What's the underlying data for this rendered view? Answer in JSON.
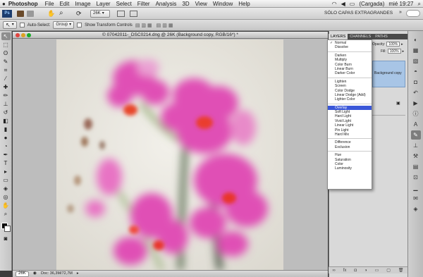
{
  "menubar": {
    "app_name": "Photoshop",
    "menus": [
      "File",
      "Edit",
      "Image",
      "Layer",
      "Select",
      "Filter",
      "Analysis",
      "3D",
      "View",
      "Window",
      "Help"
    ],
    "status": {
      "battery": "(Cargada)",
      "clock": "mié 19:27"
    }
  },
  "appbar": {
    "zoom": "26K",
    "workspace": "SÓLO CAPAS EXTRAGRANDES"
  },
  "options": {
    "auto_select_label": "Auto-Select:",
    "auto_select_value": "Group",
    "transform_label": "Show Transform Controls"
  },
  "document": {
    "title": "© 07042011-_DSC0214.dng @ 26K (Background copy, RGB/16*) *"
  },
  "status": {
    "zoom": "26K",
    "doc_size": "Doc: 36,3M/72,7M"
  },
  "panel": {
    "tabs": [
      "LAYERS",
      "CHANNELS",
      "PATHS"
    ],
    "opacity_label": "Opacity:",
    "opacity_value": "100%",
    "fill_label": "Fill:",
    "fill_value": "100%",
    "layer_name": "Background copy"
  },
  "blend_modes": {
    "groups": [
      [
        "Normal",
        "Dissolve"
      ],
      [
        "Darken",
        "Multiply",
        "Color Burn",
        "Linear Burn",
        "Darker Color"
      ],
      [
        "Lighten",
        "Screen",
        "Color Dodge",
        "Linear Dodge (Add)",
        "Lighter Color"
      ],
      [
        "Overlay",
        "Soft Light",
        "Hard Light",
        "Vivid Light",
        "Linear Light",
        "Pin Light",
        "Hard Mix"
      ],
      [
        "Difference",
        "Exclusion"
      ],
      [
        "Hue",
        "Saturation",
        "Color",
        "Luminosity"
      ]
    ],
    "checked": "Normal",
    "highlighted": "Overlay"
  },
  "colors": {
    "highlight": "#3a57d8",
    "layer_selected": "#a8c5e6",
    "orchid": "#e23fb0"
  }
}
